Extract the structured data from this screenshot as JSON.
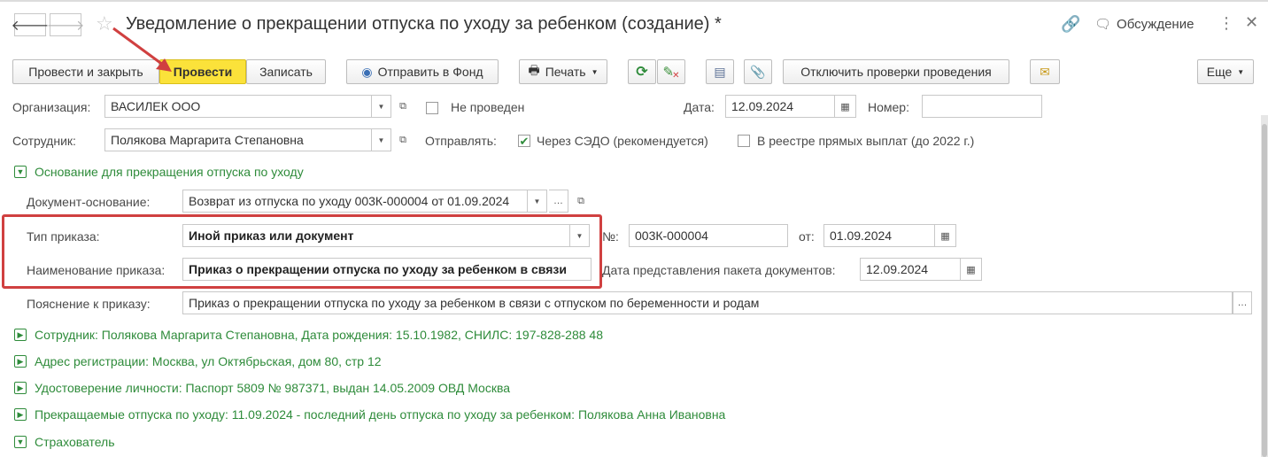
{
  "window": {
    "title": "Уведомление о прекращении отпуска по уходу за ребенком (создание) *",
    "discussion_label": "Обсуждение"
  },
  "toolbar": {
    "post_and_close": "Провести и закрыть",
    "post": "Провести",
    "save": "Записать",
    "send_to_fund": "Отправить в Фонд",
    "print": "Печать",
    "disable_checks": "Отключить проверки проведения",
    "more": "Еще"
  },
  "form": {
    "organization_label": "Организация:",
    "organization_value": "ВАСИЛЕК ООО",
    "posted_status": "Не проведен",
    "date_label": "Дата:",
    "date_value": "12.09.2024",
    "number_label": "Номер:",
    "number_value": "",
    "employee_label": "Сотрудник:",
    "employee_value": "Полякова Маргарита Степановна",
    "send_label": "Отправлять:",
    "send_sedo": "Через СЭДО (рекомендуется)",
    "send_registry": "В реестре прямых выплат (до 2022 г.)"
  },
  "basis_group": {
    "title": "Основание для прекращения отпуска по уходу",
    "doc_basis_label": "Документ-основание:",
    "doc_basis_value": "Возврат из отпуска по уходу 003К-000004 от 01.09.2024",
    "order_type_label": "Тип приказа:",
    "order_type_value": "Иной приказ или документ",
    "no_label": "№:",
    "no_value": "003К-000004",
    "from_label": "от:",
    "from_value": "01.09.2024",
    "order_name_label": "Наименование приказа:",
    "order_name_value": "Приказ о прекращении отпуска по уходу за ребенком в связи",
    "package_date_label": "Дата представления пакета документов:",
    "package_date_value": "12.09.2024",
    "explanation_label": "Пояснение к приказу:",
    "explanation_value": "Приказ о прекращении отпуска по уходу за ребенком в связи с отпуском по беременности и родам"
  },
  "collapsed_groups": [
    "Сотрудник: Полякова Маргарита Степановна, Дата рождения: 15.10.1982, СНИЛС: 197-828-288 48",
    "Адрес регистрации: Москва, ул Октябрьская, дом 80, стр 12",
    "Удостоверение личности: Паспорт 5809 № 987371, выдан 14.05.2009 ОВД Москва",
    "Прекращаемые отпуска по уходу: 11.09.2024 - последний день отпуска по уходу за ребенком: Полякова Анна Ивановна"
  ],
  "insurer_group": "Страхователь",
  "colors": {
    "accent_green": "#2e8b3a",
    "primary_yellow": "#fbe23a",
    "highlight_red": "#d04040"
  }
}
